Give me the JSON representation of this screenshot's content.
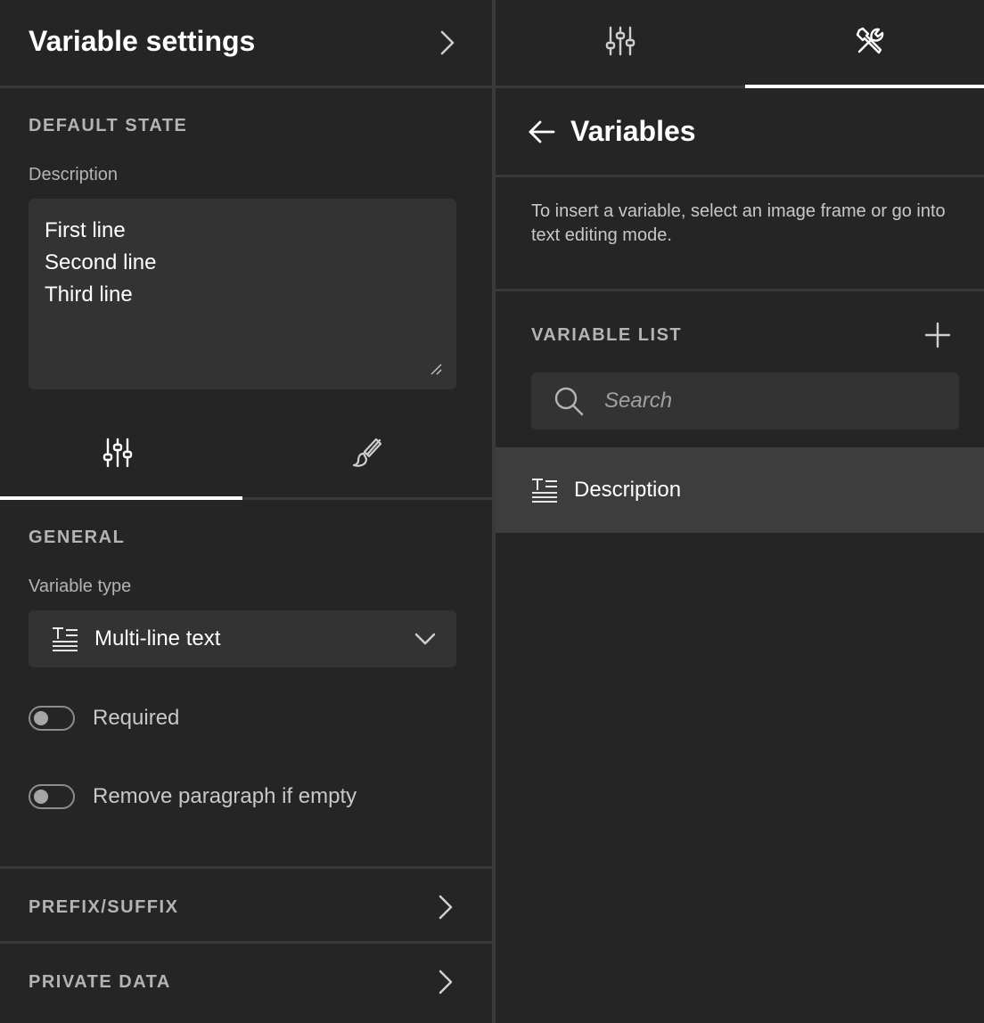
{
  "left_panel": {
    "title": "Variable settings",
    "default_state": {
      "section_label": "DEFAULT STATE",
      "description_label": "Description",
      "description_lines": [
        "First line",
        "Second line",
        "Third line"
      ]
    },
    "tabs": [
      {
        "icon": "sliders-icon",
        "active": true
      },
      {
        "icon": "brush-icon",
        "active": false
      }
    ],
    "general": {
      "section_label": "GENERAL",
      "variable_type_label": "Variable type",
      "variable_type_value": "Multi-line text",
      "toggles": [
        {
          "label": "Required",
          "on": false
        },
        {
          "label": "Remove paragraph if empty",
          "on": false
        }
      ]
    },
    "collapsibles": [
      {
        "label": "PREFIX/SUFFIX"
      },
      {
        "label": "PRIVATE DATA"
      }
    ]
  },
  "right_panel": {
    "tabs": [
      {
        "icon": "sliders-icon",
        "active": false
      },
      {
        "icon": "tools-icon",
        "active": true
      }
    ],
    "title": "Variables",
    "hint": "To insert a variable, select an image frame or go into text editing mode.",
    "variable_list_label": "VARIABLE LIST",
    "search_placeholder": "Search",
    "variables": [
      {
        "label": "Description",
        "icon": "multiline-text-icon"
      }
    ]
  },
  "colors": {
    "background": "#252525",
    "field": "#333333",
    "selected_row": "#3d3d3d",
    "divider": "#3a3a3a",
    "muted_text": "#b4b4b4"
  }
}
